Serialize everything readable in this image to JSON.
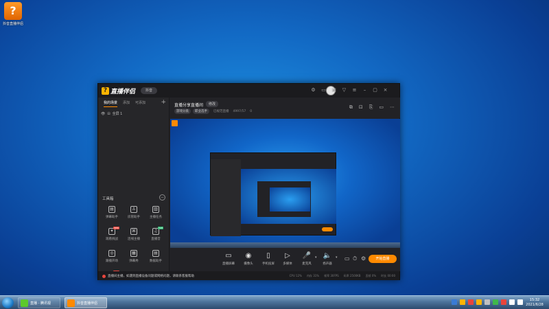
{
  "desktop": {
    "icon_label": "抖音直播伴侣",
    "icon_glyph": "?"
  },
  "app": {
    "logo_glyph": "?",
    "title": "直播伴侣",
    "region": "抖音",
    "titlebar_icons": [
      "shirt-icon",
      "message-icon",
      "screen-icon",
      "filter-icon",
      "menu-icon",
      "minimize-icon",
      "maximize-icon",
      "close-icon"
    ],
    "titlebar_glyphs": [
      "⚙",
      "▭",
      "▣",
      "▽",
      "≡",
      "–",
      "▢",
      "×"
    ]
  },
  "sidebar": {
    "tabs": [
      "我的场景",
      "添加",
      "可添加"
    ],
    "add_glyph": "+",
    "source": {
      "eye": "👁",
      "lock": "⊟",
      "label": "全屏 1"
    },
    "tools_title": "工具箱",
    "tools_collapse": "−",
    "tools": [
      {
        "label": "弹幕助手",
        "glyph": "▤",
        "badge": ""
      },
      {
        "label": "房管助手",
        "glyph": "♙",
        "badge": ""
      },
      {
        "label": "主播任务",
        "glyph": "▥",
        "badge": ""
      },
      {
        "label": "观看挑战",
        "glyph": "✦",
        "badge": "new"
      },
      {
        "label": "连线主播",
        "glyph": "⌘",
        "badge": ""
      },
      {
        "label": "直播音",
        "glyph": "♫",
        "badge": "hot"
      },
      {
        "label": "跟播开场",
        "glyph": "◎",
        "badge": ""
      },
      {
        "label": "弹幕秀",
        "glyph": "▦",
        "badge": ""
      },
      {
        "label": "数据助手",
        "glyph": "▤",
        "badge": ""
      },
      {
        "label": "",
        "glyph": "▲",
        "badge": "new"
      },
      {
        "label": "",
        "glyph": "⊕",
        "badge": ""
      },
      {
        "label": "",
        "glyph": "△",
        "badge": ""
      }
    ]
  },
  "header": {
    "live_title": "直播分享直播间",
    "edit_label": "修改",
    "category": "游戏分类",
    "tag": "职业选手",
    "subtitle": "已规范直播",
    "meta": "4997/57",
    "viewers": "0",
    "icons": [
      "screenshot-icon",
      "lock-icon",
      "export-icon",
      "record-icon",
      "share-icon"
    ],
    "icon_glyphs": [
      "⧉",
      "⊡",
      "⎘",
      "▭",
      "⋯"
    ]
  },
  "controls": {
    "items": [
      {
        "label": "直播屏幕",
        "glyph": "▭"
      },
      {
        "label": "摄像头",
        "glyph": "◉"
      },
      {
        "label": "手机投屏",
        "glyph": "▯"
      },
      {
        "label": "多媒体",
        "glyph": "▷"
      },
      {
        "label": "麦克风",
        "glyph": "🎤"
      },
      {
        "label": "扬声器",
        "glyph": "🔈"
      }
    ],
    "caret": "▾",
    "extra_glyphs": [
      "▭",
      "⏱",
      "⚙"
    ],
    "go_live_label": "开始直播"
  },
  "status": {
    "notice": "直播间主播，如遇到直播设备问题或网络问题，请联系客服帮助",
    "stats": [
      "CPU 12%",
      "内存 31%",
      "帧率 30FPS",
      "码率 2500KB",
      "丢帧 0%",
      "时长 00:00"
    ]
  },
  "taskbar": {
    "items": [
      {
        "label": "直播 - 腾讯视",
        "icon_color": "#5cc92c"
      },
      {
        "label": "抖音直播伴侣",
        "icon_color": "#ff8a00"
      }
    ],
    "tray_colors": [
      "#3a7bd5",
      "#ffb400",
      "#e8453c",
      "#ffb400",
      "#c0c0c0",
      "#3fb84b",
      "#e8453c",
      "#ffffff",
      "#ffffff"
    ],
    "time": "15:32",
    "date": "2021/6/28"
  }
}
